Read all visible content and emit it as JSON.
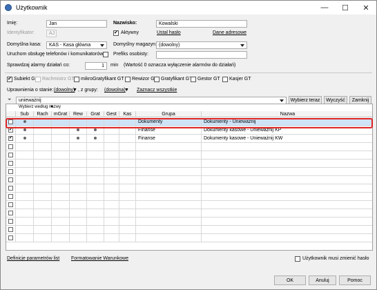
{
  "window": {
    "title": "Użytkownik"
  },
  "form": {
    "imie_label": "Imię:",
    "imie_value": "Jan",
    "nazwisko_label": "Nazwisko:",
    "nazwisko_value": "Kowalski",
    "identyfikator_label": "Identyfikator:",
    "identyfikator_value": "AJ",
    "aktywny_label": "Aktywny",
    "ustal_haslo": "Ustal hasło",
    "dane_adresowe": "Dane adresowe",
    "kasa_label": "Domyślna kasa:",
    "kasa_value": "KAS - Kasa główna",
    "magazyn_label": "Domyślny magazyn:",
    "magazyn_value": "(dowolny)",
    "telefon_label": "Uruchom obsługę telefonów i komunikatorów",
    "prefiks_label": "Prefiks osobisty:",
    "alarm_label": "Sprawdzaj alarmy działań co:",
    "alarm_value": "1",
    "alarm_unit": "min",
    "alarm_note": "(Wartość 0 oznacza wyłączenie alarmów do działań)"
  },
  "modules": [
    {
      "label": "Subiekt GT",
      "checked": true,
      "disabled": false
    },
    {
      "label": "Rachmistrz GT",
      "checked": false,
      "disabled": true
    },
    {
      "label": "mikroGratyfikant GT",
      "checked": false,
      "disabled": false
    },
    {
      "label": "Rewizor GT",
      "checked": false,
      "disabled": false
    },
    {
      "label": "Gratyfikant GT",
      "checked": false,
      "disabled": false
    },
    {
      "label": "Gestor GT",
      "checked": false,
      "disabled": false
    },
    {
      "label": "Kasjer GT",
      "checked": false,
      "disabled": false
    }
  ],
  "filters": {
    "uprawnienia_label": "Uprawnienia o stanie:",
    "stan_value": "(dowolny)",
    "grupy_label": ", z grupy:",
    "grupy_value": "(dowolna)",
    "zaznacz": "Zaznacz wszystkie"
  },
  "search": {
    "value": "unieważnij",
    "wybierz": "Wybierz teraz",
    "wyczysc": "Wyczyść",
    "zamknij": "Zamknij",
    "hint": "Wybierz według nazwy"
  },
  "grid": {
    "columns": [
      "Sub",
      "Rach",
      "mGrat",
      "Rew",
      "Grat",
      "Gest",
      "Kas",
      "Grupa",
      "Nazwa"
    ],
    "rows": [
      {
        "checked": false,
        "sub": true,
        "rew": false,
        "grat": false,
        "grupa": "Dokumenty",
        "nazwa": "Dokumenty - Unieważnij",
        "selected": true
      },
      {
        "checked": true,
        "sub": true,
        "rew": true,
        "grat": true,
        "grupa": "Finanse",
        "nazwa": "Dokumenty kasowe - Unieważnij KP",
        "selected": false
      },
      {
        "checked": true,
        "sub": true,
        "rew": true,
        "grat": true,
        "grupa": "Finanse",
        "nazwa": "Dokumenty kasowe - Unieważnij KW",
        "selected": false
      }
    ],
    "empty_rows": 12
  },
  "footer": {
    "definicje": "Definicje parametrów list",
    "formatowanie": "Formatowanie Warunkowe",
    "musi_zmienic": "Użytkownik musi zmienić hasło",
    "ok": "OK",
    "anuluj": "Anuluj",
    "pomoc": "Pomoc"
  }
}
